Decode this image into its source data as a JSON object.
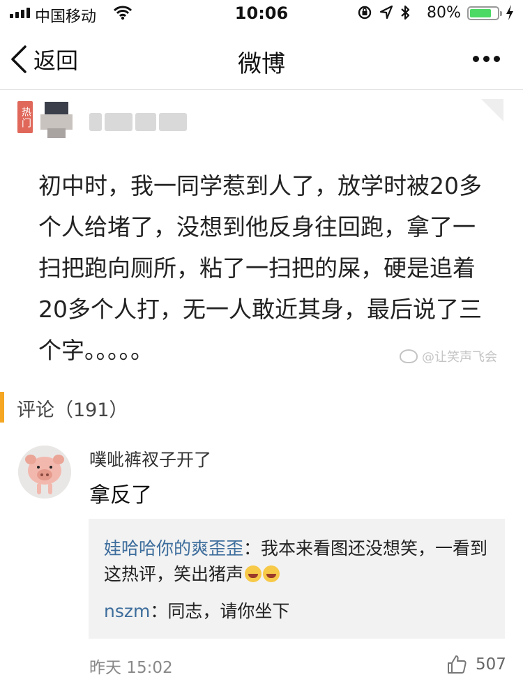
{
  "status_bar": {
    "carrier": "中国移动",
    "time": "10:06",
    "battery_percent": "80%",
    "battery_level": 0.8,
    "battery_color": "#4cd964"
  },
  "nav": {
    "back_label": "返回",
    "title": "微博",
    "more_icon": "more-dots-icon"
  },
  "post": {
    "badge": "热门",
    "text": "初中时，我一同学惹到人了，放学时被20多个人给堵了，没想到他反身往回跑，拿了一扫把跑向厕所，粘了一扫把的屎，硬是追着20多个人打，无一人敢近其身，最后说了三个字。。。。。",
    "watermark": "@让笑声飞会"
  },
  "comments": {
    "header": "评论（191）",
    "accent_color": "#f5a623",
    "items": [
      {
        "user": "噗呲裤衩子开了",
        "text": "拿反了",
        "time": "昨天 15:02",
        "likes": "507",
        "replies": [
          {
            "user": "娃哈哈你的爽歪歪",
            "sep": "：",
            "text": "我本来看图还没想笑，一看到这热评，笑出猪声"
          },
          {
            "user": "nszm",
            "sep": "：",
            "text": "同志，请你坐下"
          }
        ]
      }
    ]
  }
}
